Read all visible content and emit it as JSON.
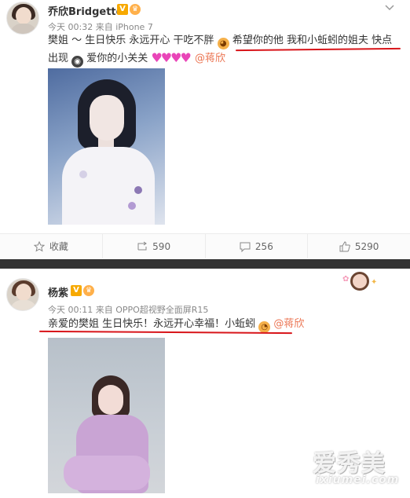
{
  "post1": {
    "username": "乔欣Bridgette",
    "badge_v": "V",
    "meta": "今天 00:32 来自 iPhone 7",
    "text_line1_a": "樊姐 ～ 生日快乐 永远开心  干吃不胖",
    "text_line1_b": "希望你的他 我和小蚯蚓的姐夫 快点",
    "text_line2_a": "出现",
    "text_line2_b": "爱你的小关关",
    "hearts": "♥♥♥♥",
    "mention": "@蒋欣",
    "actions": {
      "favorite": "收藏",
      "repost": "590",
      "comment": "256",
      "like": "5290"
    }
  },
  "post2": {
    "username": "杨紫",
    "badge_v": "V",
    "meta": "今天 00:11 来自 OPPO超视野全面屏R15",
    "text": "亲爱的樊姐 生日快乐！永远开心幸福！小蚯蚓",
    "mention": "@蒋欣"
  },
  "watermark": {
    "big": "爱秀美",
    "small": "ixiumei.com"
  },
  "colors": {
    "mention": "#eb7350",
    "underline": "#d8151a",
    "divider": "#333333"
  }
}
